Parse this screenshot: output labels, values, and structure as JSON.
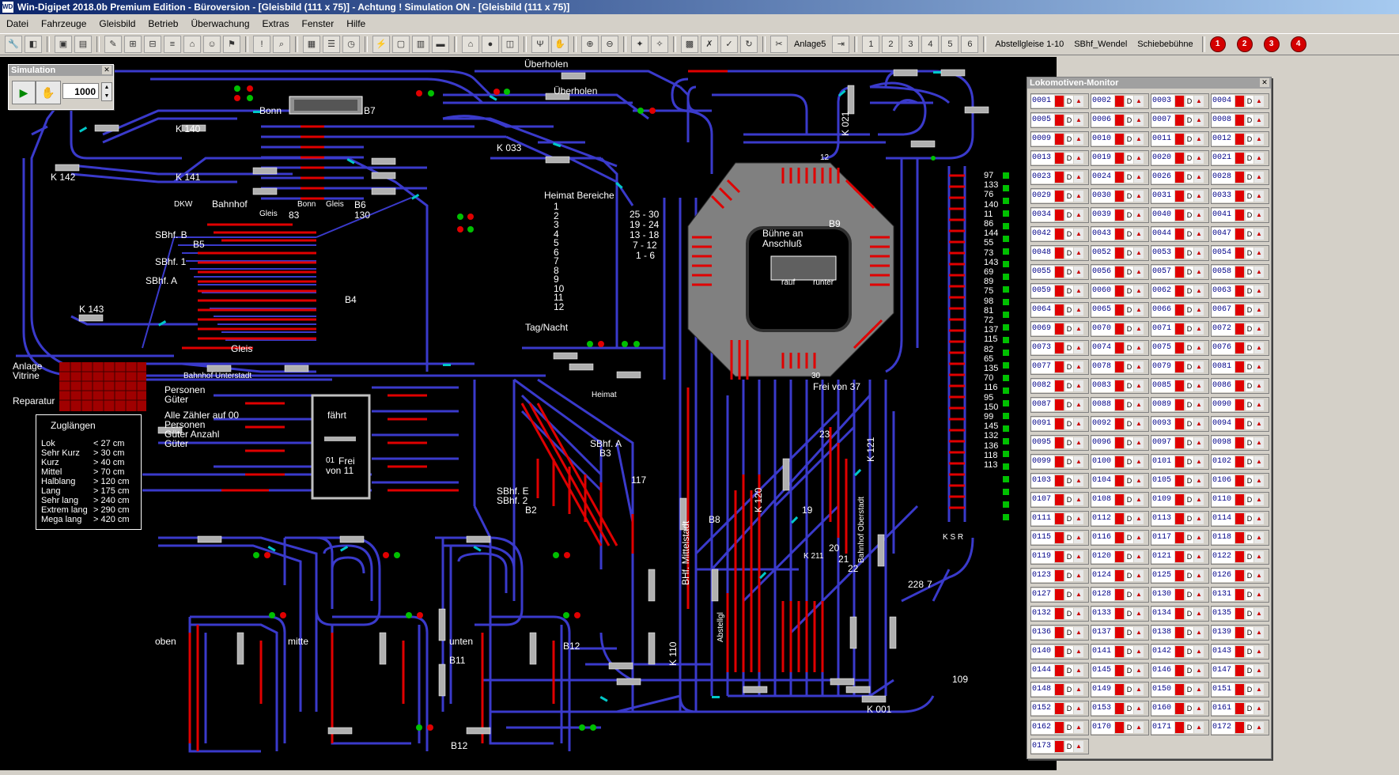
{
  "window": {
    "title": "Win-Digipet 2018.0b Premium Edition - Büroversion - [Gleisbild (111 x 75)] - Achtung ! Simulation ON - [Gleisbild (111 x 75)]",
    "app_icon": "WDP"
  },
  "menu": [
    "Datei",
    "Fahrzeuge",
    "Gleisbild",
    "Betrieb",
    "Überwachung",
    "Extras",
    "Fenster",
    "Hilfe"
  ],
  "toolbar": {
    "anlage": "Anlage5",
    "abstellgleise": "Abstellgleise 1-10",
    "sbhf": "SBhf_Wendel",
    "schiebebuehne": "Schiebebühne",
    "stops": [
      "1",
      "2",
      "3",
      "4"
    ],
    "profiles": [
      "1",
      "2",
      "3",
      "4",
      "5",
      "6"
    ]
  },
  "simulation": {
    "title": "Simulation",
    "speed": "1000"
  },
  "layout_labels": {
    "ueberholen_top": "Überholen",
    "ueberholen_2": "Überholen",
    "bonn": "Bonn",
    "b7": "B7",
    "k140": "K 140",
    "k141": "K 141",
    "k142": "K 142",
    "k143": "K 143",
    "k033": "K 033",
    "k021": "K 021",
    "dkw": "DKW",
    "bahnhof": "Bahnhof",
    "gleis": "Gleis",
    "g83": "83",
    "bonn2": "Bonn",
    "gleis2": "Gleis",
    "b6": "B6",
    "g130": "130",
    "sbhf_b": "SBhf. B",
    "b5": "B5",
    "sbhf_1": "SBhf. 1",
    "sbhf_a": "SBhf. A",
    "b4": "B4",
    "gleis_bottom": "Gleis",
    "bahnhof_unterstadt": "Bahnhof  Unterstadt",
    "heimat_bereiche": "Heimat Bereiche",
    "tag_nacht": "Tag/Nacht",
    "r25_30": "25 - 30",
    "r19_24": "19 - 24",
    "r13_18": "13 - 18",
    "r7_12": "7 - 12",
    "r1_6": "1 - 6",
    "buehne": "Bühne an",
    "anschluss": "Anschluß",
    "b9": "B9",
    "rauf": "rauf",
    "runter": "runter",
    "g12": "12",
    "g30": "30",
    "frei_von_37": "Frei von 37",
    "anlage": "Anlage",
    "vitrine": "Vitrine",
    "reparatur": "Reparatur",
    "personen": "Personen",
    "gueter": "Güter",
    "alle_zaehler": "Alle Zähler auf 00",
    "personen2": "Personen",
    "gueter_anzahl": "Güter  Anzahl",
    "gueter2": "Güter",
    "faehrt": "fährt",
    "frei": "Frei",
    "von_11": "von 11",
    "b01": "01",
    "heimat": "Heimat",
    "sbhf_a2": "SBhf. A",
    "b3": "B3",
    "sbhf_e": "SBhf. E",
    "sbhf_2": "SBhf. 2",
    "b2": "B2",
    "g117": "117",
    "oben": "oben",
    "mitte": "mitte",
    "unten": "unten",
    "b11": "B11",
    "b12": "B12",
    "b12b": "B12",
    "b8": "B8",
    "bhf_mittelstadt": "BHf. Mittelstadt",
    "bahnhof_oberstadt": "Bahnhof Oberstadt",
    "k120": "K 120",
    "k121": "K 121",
    "k110": "K 110",
    "k001": "K 001",
    "k_211": "K 211",
    "g23": "23",
    "g19": "19",
    "g20": "20",
    "g21": "21",
    "g22": "22",
    "g109": "109",
    "g228": "228",
    "g7": "7",
    "ksr": "K S R",
    "abstellgl": "Abstellgl"
  },
  "heimat_list": [
    "1",
    "2",
    "3",
    "4",
    "5",
    "6",
    "7",
    "8",
    "9",
    "10",
    "11",
    "12"
  ],
  "zuglaengen": {
    "title": "Zuglängen",
    "rows": [
      {
        "n": "Lok",
        "v": "< 27 cm"
      },
      {
        "n": "Sehr Kurz",
        "v": "> 30 cm"
      },
      {
        "n": "Kurz",
        "v": "> 40 cm"
      },
      {
        "n": "Mittel",
        "v": "> 70 cm"
      },
      {
        "n": "Halblang",
        "v": "> 120 cm"
      },
      {
        "n": "Lang",
        "v": "> 175 cm"
      },
      {
        "n": "Sehr lang",
        "v": "> 240 cm"
      },
      {
        "n": "Extrem lang",
        "v": "> 290 cm"
      },
      {
        "n": "Mega lang",
        "v": "> 420 cm"
      }
    ]
  },
  "right_column_numbers": [
    "97",
    "133",
    "76",
    "140",
    "11",
    "86",
    "144",
    "55",
    "73",
    "143",
    "69",
    "89",
    "75",
    "98",
    "81",
    "72",
    "137",
    "115",
    "82",
    "65",
    "135",
    "70",
    "116",
    "95",
    "150",
    "99",
    "145",
    "132",
    "136",
    "118",
    "113"
  ],
  "lok_monitor": {
    "title": "Lokomotiven-Monitor",
    "locos": [
      "0001",
      "0002",
      "0003",
      "0004",
      "0005",
      "0006",
      "0007",
      "0008",
      "0009",
      "0010",
      "0011",
      "0012",
      "0013",
      "0019",
      "0020",
      "0021",
      "0023",
      "0024",
      "0026",
      "0028",
      "0029",
      "0030",
      "0031",
      "0033",
      "0034",
      "0039",
      "0040",
      "0041",
      "0042",
      "0043",
      "0044",
      "0047",
      "0048",
      "0052",
      "0053",
      "0054",
      "0055",
      "0056",
      "0057",
      "0058",
      "0059",
      "0060",
      "0062",
      "0063",
      "0064",
      "0065",
      "0066",
      "0067",
      "0069",
      "0070",
      "0071",
      "0072",
      "0073",
      "0074",
      "0075",
      "0076",
      "0077",
      "0078",
      "0079",
      "0081",
      "0082",
      "0083",
      "0085",
      "0086",
      "0087",
      "0088",
      "0089",
      "0090",
      "0091",
      "0092",
      "0093",
      "0094",
      "0095",
      "0096",
      "0097",
      "0098",
      "0099",
      "0100",
      "0101",
      "0102",
      "0103",
      "0104",
      "0105",
      "0106",
      "0107",
      "0108",
      "0109",
      "0110",
      "0111",
      "0112",
      "0113",
      "0114",
      "0115",
      "0116",
      "0117",
      "0118",
      "0119",
      "0120",
      "0121",
      "0122",
      "0123",
      "0124",
      "0125",
      "0126",
      "0127",
      "0128",
      "0130",
      "0131",
      "0132",
      "0133",
      "0134",
      "0135",
      "0136",
      "0137",
      "0138",
      "0139",
      "0140",
      "0141",
      "0142",
      "0143",
      "0144",
      "0145",
      "0146",
      "0147",
      "0148",
      "0149",
      "0150",
      "0151",
      "0152",
      "0153",
      "0160",
      "0161",
      "0162",
      "0170",
      "0171",
      "0172",
      "0173"
    ]
  },
  "colors": {
    "track": "#3a3acb",
    "occupied": "#e00000",
    "switch_tip": "#00c8c8",
    "background": "#000000",
    "signal_green": "#00c000"
  }
}
